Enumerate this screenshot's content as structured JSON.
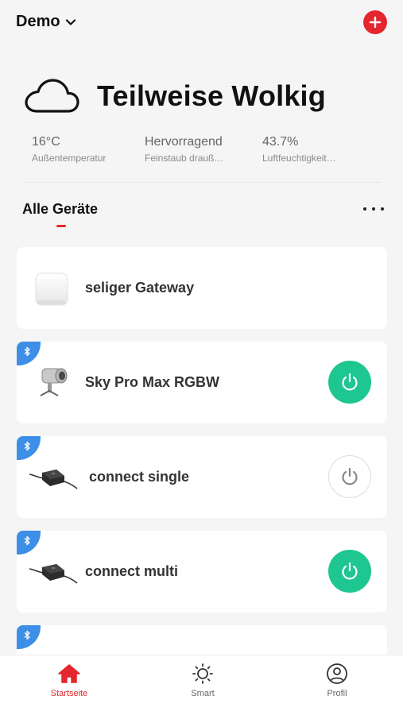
{
  "header": {
    "home_name": "Demo",
    "home_dropdown_icon": "chevron-down-icon",
    "add_icon": "plus-icon",
    "accent_color": "#e4262e"
  },
  "weather": {
    "icon": "cloud-icon",
    "condition": "Teilweise Wolkig",
    "stats": [
      {
        "value": "16°C",
        "label": "Außentemperatur"
      },
      {
        "value": "Hervorragend",
        "label": "Feinstaub drauß…"
      },
      {
        "value": "43.7%",
        "label": "Luftfeuchtigkeit…"
      }
    ]
  },
  "section": {
    "title": "Alle Geräte",
    "more_icon": "more-horizontal-icon"
  },
  "devices": [
    {
      "name": "seliger Gateway",
      "bluetooth": false,
      "power": null
    },
    {
      "name": "Sky Pro Max RGBW",
      "bluetooth": true,
      "power": "on"
    },
    {
      "name": "connect single",
      "bluetooth": true,
      "power": "off"
    },
    {
      "name": "connect multi",
      "bluetooth": true,
      "power": "on"
    },
    {
      "name": "",
      "bluetooth": true,
      "power": null
    }
  ],
  "colors": {
    "power_on": "#1ec690",
    "bluetooth": "#3c8ee6"
  },
  "bottom_nav": [
    {
      "label": "Startseite",
      "icon": "home-icon",
      "active": true
    },
    {
      "label": "Smart",
      "icon": "sun-icon",
      "active": false
    },
    {
      "label": "Profil",
      "icon": "user-icon",
      "active": false
    }
  ]
}
